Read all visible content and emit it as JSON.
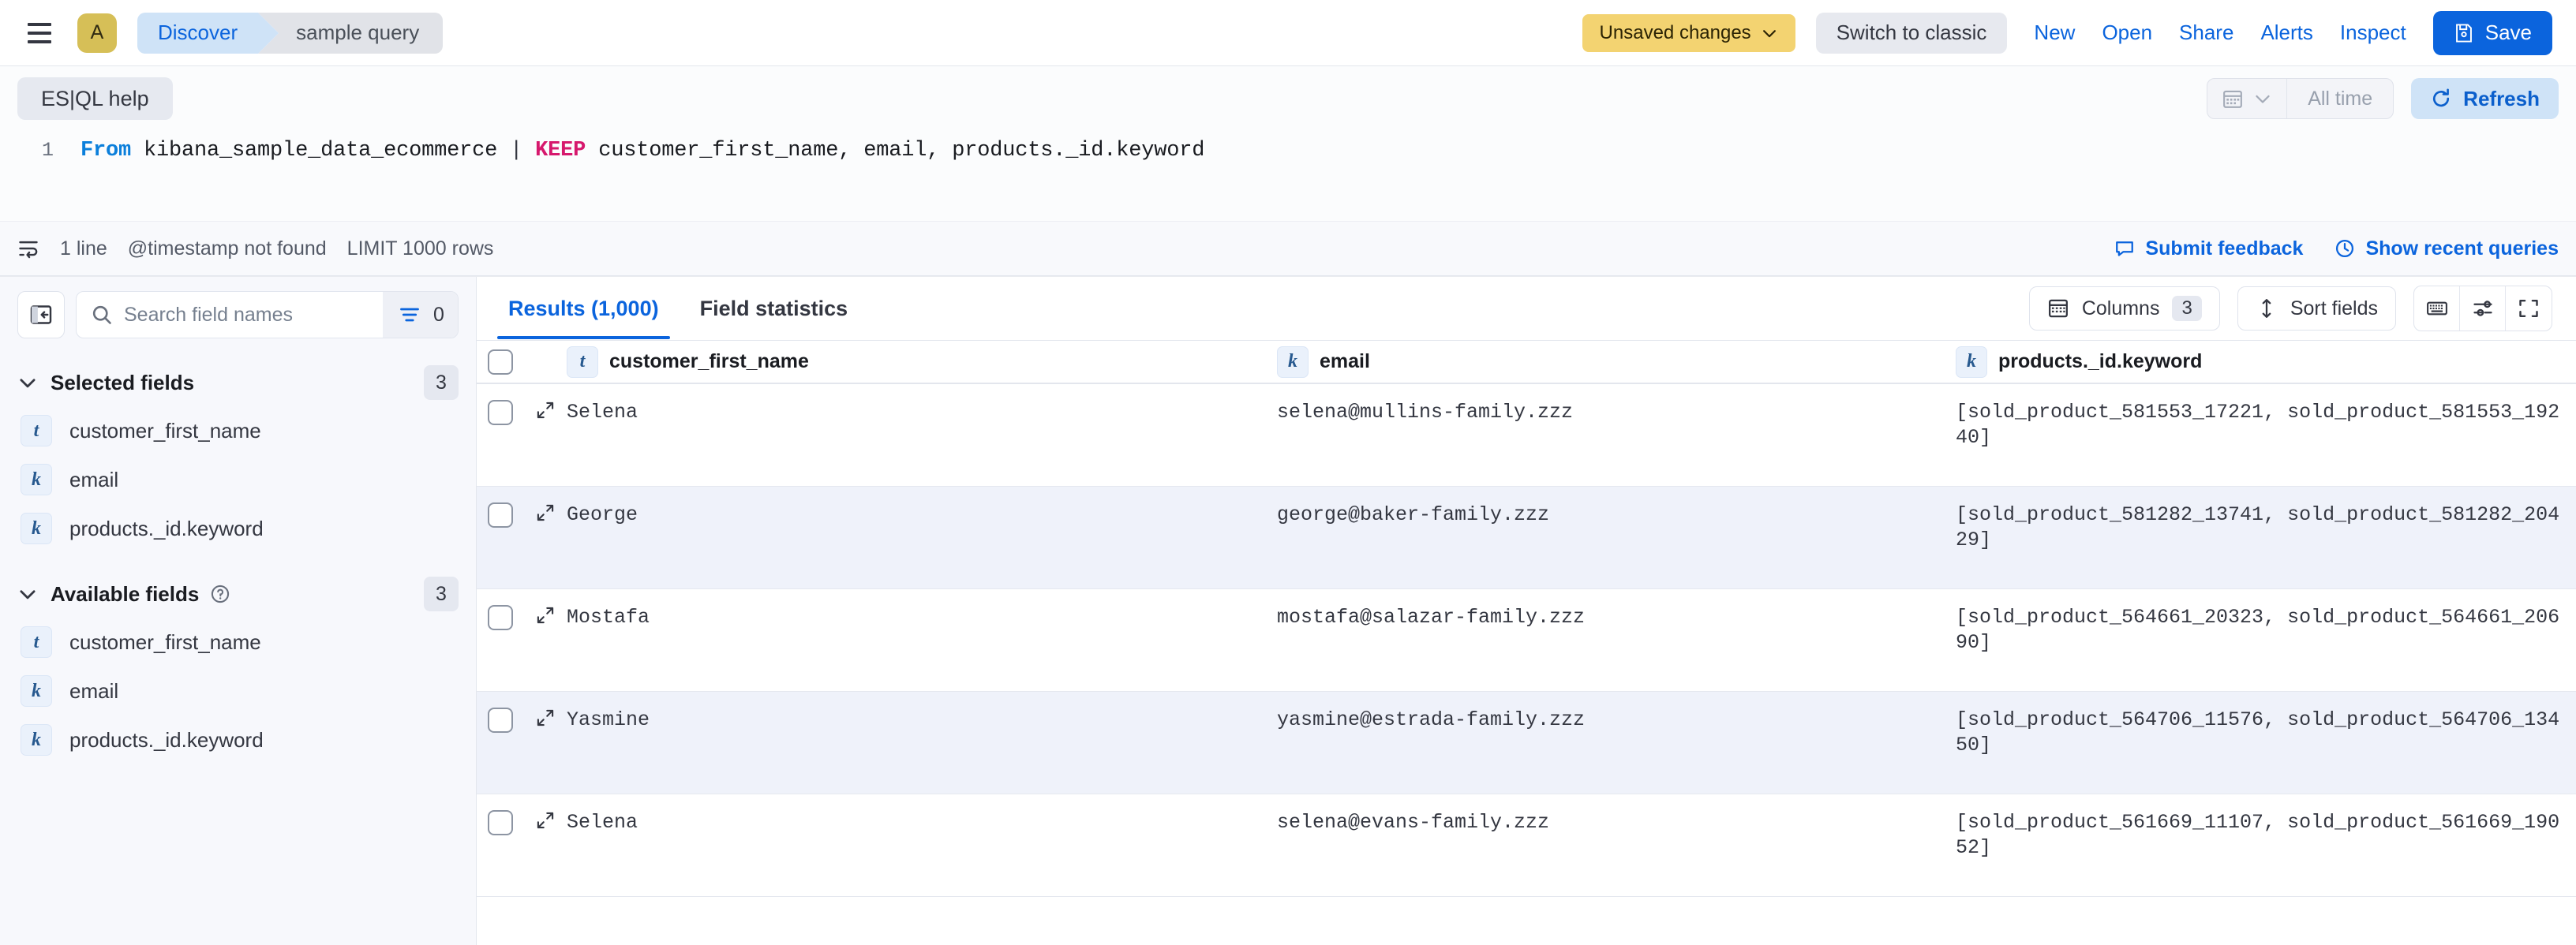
{
  "header": {
    "menu_icon": "hamburger-icon",
    "space_initial": "A",
    "breadcrumbs": [
      {
        "label": "Discover"
      },
      {
        "label": "sample query"
      }
    ],
    "unsaved_changes_label": "Unsaved changes",
    "switch_to_classic_label": "Switch to classic",
    "links": [
      {
        "label": "New",
        "name": "new-button"
      },
      {
        "label": "Open",
        "name": "open-button"
      },
      {
        "label": "Share",
        "name": "share-button"
      },
      {
        "label": "Alerts",
        "name": "alerts-button"
      },
      {
        "label": "Inspect",
        "name": "inspect-button"
      }
    ],
    "save_label": "Save",
    "accent_blue": "#0b64dd",
    "unsaved_yellow": "#f3d371"
  },
  "querybar": {
    "esql_help_label": "ES|QL help",
    "time_range_label": "All time",
    "refresh_label": "Refresh",
    "line_number": "1",
    "query": {
      "keyword_from": "From",
      "index": "kibana_sample_data_ecommerce",
      "pipe": "|",
      "keyword_keep": "KEEP",
      "columns": "customer_first_name, email, products._id.keyword"
    },
    "status": {
      "lines": "1 line",
      "timestamp_note": "@timestamp not found",
      "limit": "LIMIT 1000 rows"
    },
    "submit_feedback_label": "Submit feedback",
    "show_recent_queries_label": "Show recent queries"
  },
  "sidebar": {
    "search_placeholder": "Search field names",
    "search_value": "",
    "filter_count": "0",
    "groups": [
      {
        "title": "Selected fields",
        "count": "3",
        "has_help": false,
        "fields": [
          {
            "type": "t",
            "name": "customer_first_name"
          },
          {
            "type": "k",
            "name": "email"
          },
          {
            "type": "k",
            "name": "products._id.keyword"
          }
        ]
      },
      {
        "title": "Available fields",
        "count": "3",
        "has_help": true,
        "fields": [
          {
            "type": "t",
            "name": "customer_first_name"
          },
          {
            "type": "k",
            "name": "email"
          },
          {
            "type": "k",
            "name": "products._id.keyword"
          }
        ]
      }
    ]
  },
  "main": {
    "tabs": [
      {
        "label": "Results (1,000)",
        "active": true
      },
      {
        "label": "Field statistics",
        "active": false
      }
    ],
    "columns_label": "Columns",
    "columns_count": "3",
    "sort_fields_label": "Sort fields",
    "table": {
      "headers": [
        {
          "type": "t",
          "label": "customer_first_name"
        },
        {
          "type": "k",
          "label": "email"
        },
        {
          "type": "k",
          "label": "products._id.keyword"
        }
      ],
      "rows": [
        {
          "customer_first_name": "Selena",
          "email": "selena@mullins-family.zzz",
          "products_id_keyword": "[sold_product_581553_17221, sold_product_581553_19240]"
        },
        {
          "customer_first_name": "George",
          "email": "george@baker-family.zzz",
          "products_id_keyword": "[sold_product_581282_13741, sold_product_581282_20429]"
        },
        {
          "customer_first_name": "Mostafa",
          "email": "mostafa@salazar-family.zzz",
          "products_id_keyword": "[sold_product_564661_20323, sold_product_564661_20690]"
        },
        {
          "customer_first_name": "Yasmine",
          "email": "yasmine@estrada-family.zzz",
          "products_id_keyword": "[sold_product_564706_11576, sold_product_564706_13450]"
        },
        {
          "customer_first_name": "Selena",
          "email": "selena@evans-family.zzz",
          "products_id_keyword": "[sold_product_561669_11107, sold_product_561669_19052]"
        }
      ]
    }
  }
}
